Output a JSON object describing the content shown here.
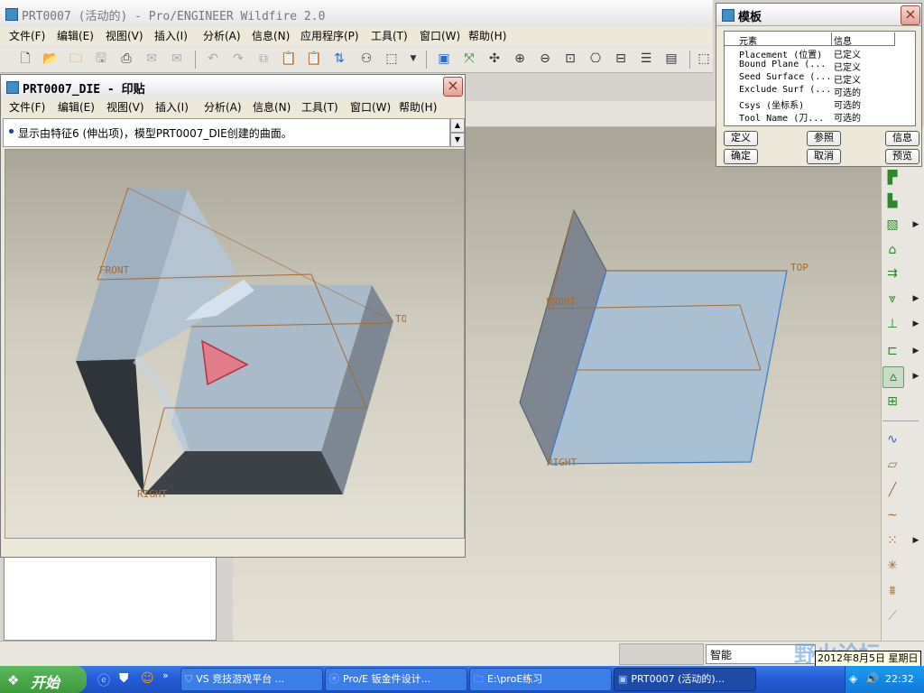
{
  "main_window": {
    "title": "PRT0007 (活动的) - Pro/ENGINEER Wildfire 2.0",
    "menu": [
      "文件(F)",
      "编辑(E)",
      "视图(V)",
      "插入(I)",
      "分析(A)",
      "信息(N)",
      "应用程序(P)",
      "工具(T)",
      "窗口(W)",
      "帮助(H)"
    ]
  },
  "die_window": {
    "title": "PRT0007_DIE - 印贴",
    "menu": [
      "文件(F)",
      "编辑(E)",
      "视图(V)",
      "插入(I)",
      "分析(A)",
      "信息(N)",
      "工具(T)",
      "窗口(W)",
      "帮助(H)"
    ],
    "message": "显示由特征6 (伸出项)，模型PRT0007_DIE创建的曲面。",
    "datum_labels": {
      "front": "FRONT",
      "top": "TOP",
      "right": "RIGHT"
    }
  },
  "main_viewport": {
    "datum_labels": {
      "front": "FRONT",
      "top": "TOP",
      "right": "RIGHT"
    }
  },
  "template_dialog": {
    "title": "模板",
    "headers": [
      "元素",
      "信息"
    ],
    "rows": [
      [
        "Placement (位置)",
        "已定义"
      ],
      [
        "Bound Plane (...",
        "已定义"
      ],
      [
        "Seed Surface (...",
        "已定义"
      ],
      [
        "Exclude Surf (...",
        "可选的"
      ],
      [
        "Csys (坐标系)",
        "可选的"
      ],
      [
        "Tool Name (刀...",
        "可选的"
      ]
    ],
    "buttons": {
      "define": "定义",
      "reference": "参照",
      "info": "信息",
      "ok": "确定",
      "cancel": "取消",
      "preview": "预览"
    }
  },
  "status": {
    "filter": "智能"
  },
  "watermark": "野火论坛",
  "taskbar": {
    "start": "开始",
    "tasks": [
      "VS 竞技游戏平台 ...",
      "Pro/E 钣金件设计...",
      "E:\\proE练习",
      "PRT0007 (活动的)..."
    ],
    "tooltip_date": "2012年8月5日 星期日",
    "clock": "22:32"
  },
  "colors": {
    "title_blue": "#0a246a",
    "taskbar_blue": "#245edb",
    "start_green": "#3c9a3c",
    "datum_orange": "#a86a30",
    "surface_blue": "#a9bfd2"
  }
}
